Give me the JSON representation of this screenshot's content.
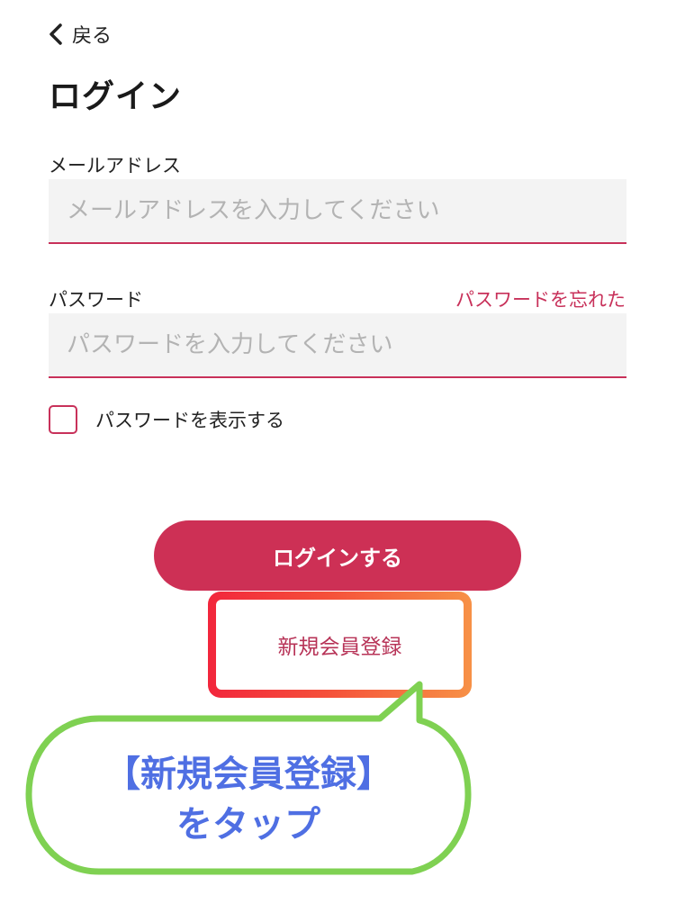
{
  "header": {
    "back_label": "戻る",
    "title": "ログイン"
  },
  "email": {
    "label": "メールアドレス",
    "value": "",
    "placeholder": "メールアドレスを入力してください"
  },
  "password": {
    "label": "パスワード",
    "forgot_label": "パスワードを忘れた",
    "value": "",
    "placeholder": "パスワードを入力してください"
  },
  "show_password": {
    "label": "パスワードを表示する",
    "checked": false
  },
  "login_button": {
    "label": "ログインする"
  },
  "register": {
    "label": "新規会員登録"
  },
  "annotation": {
    "line1": "【新規会員登録】",
    "line2": "をタップ"
  },
  "icons": {
    "back": "chevron-left-icon"
  },
  "colors": {
    "accent": "#cd3055",
    "link": "#c8315a",
    "highlight_start": "#f2263c",
    "highlight_end": "#f79146",
    "callout_border": "#7fd152",
    "callout_text": "#4f6fe3",
    "field_background": "#f3f3f3"
  }
}
